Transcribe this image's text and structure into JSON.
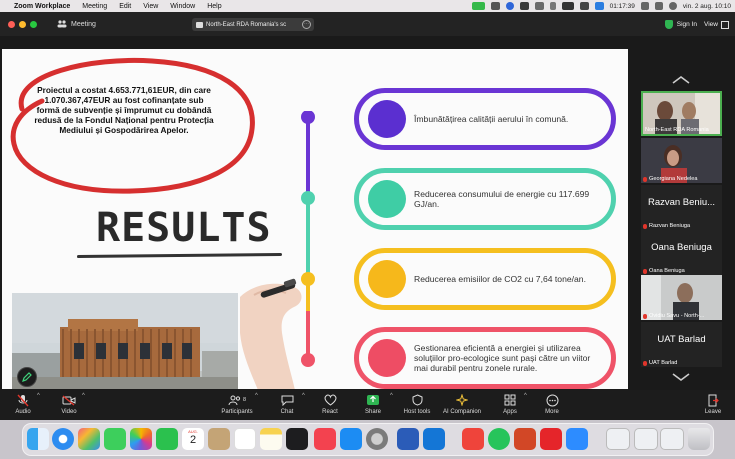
{
  "menubar": {
    "app": "Zoom Workplace",
    "items": [
      "Meeting",
      "Edit",
      "View",
      "Window",
      "Help"
    ],
    "clock_small": "01:17:39",
    "datetime": "vin. 2 aug.  10:10"
  },
  "titlebar": {
    "meeting": "Meeting",
    "share_title": "North-East RDA Romania's sc",
    "signin": "Sign In",
    "view": "View"
  },
  "slide": {
    "intro_text": "Proiectul a costat 4.653.771,61EUR, din care 1.070.367,47EUR au fost cofinanțate sub formă de subvenție și împrumut cu dobândă redusă de la Fondul Național pentru Protecția Mediului și Gospodărirea Apelor.",
    "results_heading": "RESULTS",
    "cards": [
      {
        "text": "Îmbunătățirea calității aerului în comună.",
        "color": "#6a35d4",
        "dot": "#5b2fd0"
      },
      {
        "text": "Reducerea consumului de energie cu 117.699 GJ/an.",
        "color": "#4fd1ae",
        "dot": "#3fcda5"
      },
      {
        "text": "Reducerea emisiilor de CO2 cu 7,64 tone/an.",
        "color": "#f5bf1f",
        "dot": "#f6b81b"
      },
      {
        "text": "Gestionarea eficientă a energiei și utilizarea soluțiilor pro-ecologice sunt pași către un viitor mai durabil pentru zonele rurale.",
        "color": "#ef5368",
        "dot": "#ee4d64"
      }
    ],
    "colors": {
      "ellipse": "#d62f2f",
      "timeline_top": "#6a35d4",
      "timeline_mid": "#4fd1ae",
      "timeline_low": "#f5bf1f",
      "timeline_bottom": "#ef5368"
    }
  },
  "participants_panel": {
    "tiles": [
      {
        "name": "North-East RDA Romania",
        "video": true,
        "muted": false
      },
      {
        "name": "Georgiana Nedelea",
        "video": true,
        "muted": true
      },
      {
        "display": "Razvan Beniu...",
        "name": "Razvan Beniuga",
        "video": false,
        "muted": true
      },
      {
        "display": "Oana Beniuga",
        "name": "Oana Beniuga",
        "video": false,
        "muted": true
      },
      {
        "name": "Ovidiu Savu - North-...",
        "video": true,
        "muted": true
      },
      {
        "display": "UAT Barlad",
        "name": "UAT Barlad",
        "video": false,
        "muted": true
      }
    ]
  },
  "toolbar": {
    "audio": "Audio",
    "video": "Video",
    "participants": "Participants",
    "participants_count": "8",
    "chat": "Chat",
    "react": "React",
    "share": "Share",
    "host_tools": "Host tools",
    "ai_companion": "AI Companion",
    "apps": "Apps",
    "more": "More",
    "leave": "Leave"
  },
  "dock": {
    "calendar_month": "AUG.",
    "calendar_day": "2",
    "apps": [
      "finder-icon",
      "safari-icon",
      "launchpad-icon",
      "messages-icon",
      "photos-icon",
      "facetime-icon",
      "calendar-icon",
      "contacts-icon",
      "reminders-icon",
      "notes-icon",
      "music-icon",
      "appstore-icon",
      "settings-icon",
      "word-icon",
      "outlook-icon",
      "anydesk-icon",
      "whatsapp-icon",
      "powerpoint-icon",
      "acrobat-icon",
      "zoom-icon"
    ]
  }
}
